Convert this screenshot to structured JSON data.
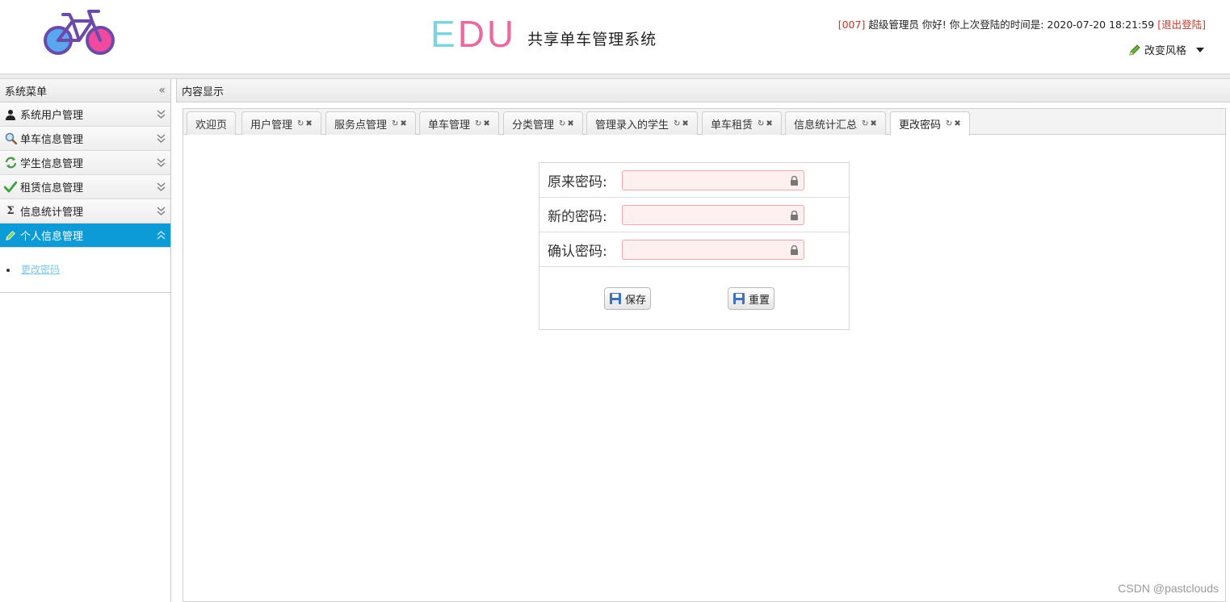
{
  "header": {
    "brand_edu": [
      "E",
      "D",
      "U"
    ],
    "brand_sub": "共享单车管理系统",
    "user_id": "[007]",
    "greeting": "超级管理员 你好! 你上次登陆的时间是:",
    "last_login": "2020-07-20 18:21:59",
    "logout_label": "[退出登陆]",
    "theme_label": "改变风格"
  },
  "sidebar": {
    "title": "系统菜单",
    "items": [
      {
        "label": "系统用户管理",
        "icon": "user-icon"
      },
      {
        "label": "单车信息管理",
        "icon": "search-icon"
      },
      {
        "label": "学生信息管理",
        "icon": "refresh-icon"
      },
      {
        "label": "租赁信息管理",
        "icon": "check-icon"
      },
      {
        "label": "信息统计管理",
        "icon": "sigma-icon"
      },
      {
        "label": "个人信息管理",
        "icon": "pencil-icon",
        "active": true
      }
    ],
    "submenu": [
      {
        "label": "更改密码"
      }
    ]
  },
  "content": {
    "title": "内容显示",
    "tabs": [
      {
        "label": "欢迎页"
      },
      {
        "label": "用户管理"
      },
      {
        "label": "服务点管理"
      },
      {
        "label": "单车管理"
      },
      {
        "label": "分类管理"
      },
      {
        "label": "管理录入的学生"
      },
      {
        "label": "单车租赁"
      },
      {
        "label": "信息统计汇总"
      },
      {
        "label": "更改密码",
        "active": true
      }
    ]
  },
  "form": {
    "old_password_label": "原来密码:",
    "new_password_label": "新的密码:",
    "confirm_password_label": "确认密码:",
    "old_password_value": "",
    "new_password_value": "",
    "confirm_password_value": "",
    "save_label": "保存",
    "reset_label": "重置"
  },
  "watermark": "CSDN @pastclouds",
  "colors": {
    "active_menu": "#0d9bd8",
    "link": "#7cc7ea",
    "accent_red": "#c0392b",
    "input_bg": "#fff0f0"
  }
}
